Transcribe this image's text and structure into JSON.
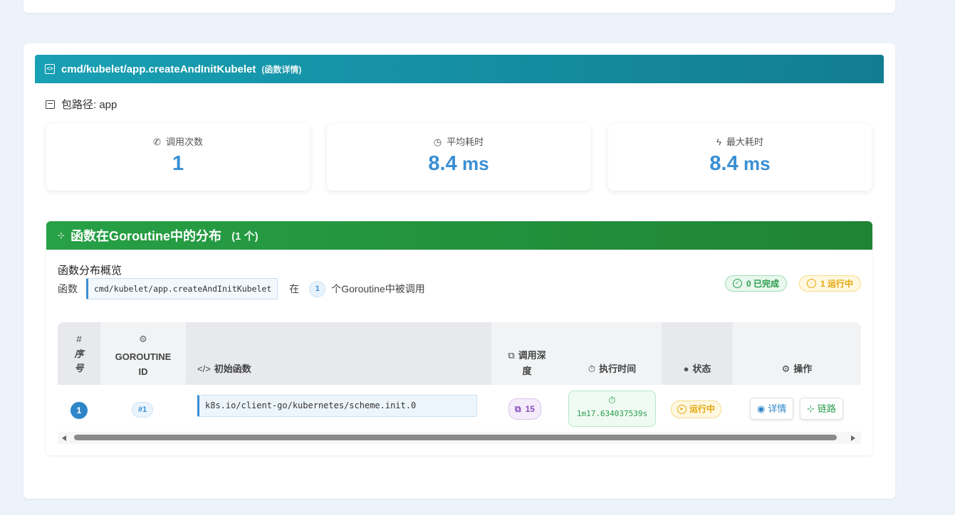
{
  "function": {
    "name": "cmd/kubelet/app.createAndInitKubelet",
    "subtitle": "(函数详情)",
    "package_label": "包路径: app"
  },
  "stats": [
    {
      "label": "调用次数",
      "value": "1",
      "unit": "",
      "icon": "phone-icon"
    },
    {
      "label": "平均耗时",
      "value": "8.4",
      "unit": " ms",
      "icon": "clock-icon"
    },
    {
      "label": "最大耗时",
      "value": "8.4",
      "unit": " ms",
      "icon": "bolt-icon"
    }
  ],
  "distribution": {
    "title": "函数在Goroutine中的分布",
    "count": "(1 个)",
    "overview_title": "函数分布概览",
    "prefix": "函数",
    "func_name": "cmd/kubelet/app.createAndInitKubelet",
    "in_text": "在",
    "goroutine_count": "1",
    "suffix": "个Goroutine中被调用",
    "done_badge": "0 已完成",
    "running_badge": "1 运行中"
  },
  "table": {
    "headers": {
      "index_hash": "#",
      "index": "序号",
      "goroutine_id": "GOROUTINE ID",
      "init_func": "初始函数",
      "depth": "调用深度",
      "exec_time": "执行时间",
      "status": "状态",
      "actions": "操作"
    },
    "rows": [
      {
        "index": "1",
        "goroutine_id": "#1",
        "init_func": "k8s.io/client-go/kubernetes/scheme.init.0",
        "depth": "15",
        "exec_time": "1m17.634037539s",
        "status": "运行中",
        "detail_btn": "详情",
        "chain_btn": "链路"
      }
    ]
  },
  "colors": {
    "func_header": "#18a0b4",
    "dist_header": "#27a046",
    "accent_blue": "#3a8fd4",
    "running": "#e3a60c",
    "done": "#2a9d4b"
  }
}
